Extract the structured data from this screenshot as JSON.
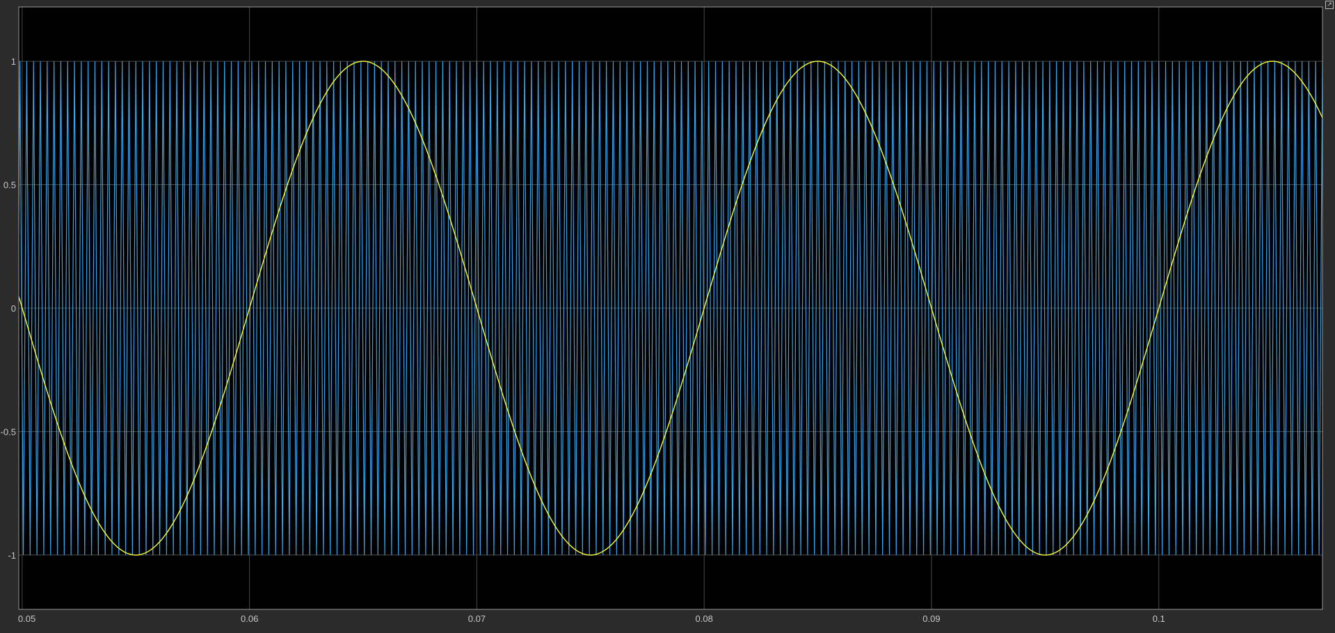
{
  "chart_data": {
    "type": "line",
    "title": "",
    "xlabel": "",
    "ylabel": "",
    "xlim": [
      0.04985,
      0.1072
    ],
    "ylim": [
      -1.22,
      1.22
    ],
    "x_ticks": [
      0.05,
      0.06,
      0.07,
      0.08,
      0.09,
      0.1
    ],
    "x_tick_labels": [
      "0.05",
      "0.06",
      "0.07",
      "0.08",
      "0.09",
      "0.1"
    ],
    "y_ticks": [
      -1,
      -0.5,
      0,
      0.5,
      1
    ],
    "y_tick_labels": [
      "-1",
      "-0.5",
      "0",
      "0.5",
      "1"
    ],
    "grid": true,
    "legend": "none",
    "background": "#000000",
    "series": [
      {
        "kind": "triangle-carrier",
        "color": "#3ba3e6",
        "amplitude": 1,
        "period": 0.0003,
        "x_start": 0.04985,
        "x_end": 0.1072,
        "first_peak_x": 0.0502
      },
      {
        "kind": "sine-reference",
        "color": "#ffff33",
        "amplitude": 1,
        "frequency_hz": 50,
        "peak_x": 0.065,
        "trough_x": 0.055
      }
    ]
  },
  "window": {
    "corner_button_icon": "undock-icon"
  }
}
